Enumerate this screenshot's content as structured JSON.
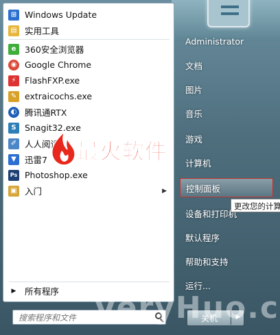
{
  "start_menu": {
    "programs": [
      {
        "label": "Windows Update",
        "icon": "windows-update-icon",
        "color": "#2a6fd0",
        "glyph": "⊞"
      },
      {
        "label": "实用工具",
        "icon": "folder-icon",
        "color": "#e6b53a",
        "glyph": "▤"
      },
      {
        "label": "360安全浏览器",
        "icon": "360-browser-icon",
        "color": "#3fae3a",
        "glyph": "e"
      },
      {
        "label": "Google Chrome",
        "icon": "chrome-icon",
        "color": "#d94a38",
        "glyph": "◉"
      },
      {
        "label": "FlashFXP.exe",
        "icon": "flashfxp-icon",
        "color": "#d33",
        "glyph": "⚡"
      },
      {
        "label": "extraicochs.exe",
        "icon": "extraicochs-icon",
        "color": "#d8a22a",
        "glyph": "✎"
      },
      {
        "label": "腾讯通RTX",
        "icon": "rtx-icon",
        "color": "#1f5fb5",
        "glyph": "◐"
      },
      {
        "label": "Snagit32.exe",
        "icon": "snagit-icon",
        "color": "#2d7fb8",
        "glyph": "S"
      },
      {
        "label": "人人阅读",
        "icon": "reader-icon",
        "color": "#4a86c8",
        "glyph": "✐"
      },
      {
        "label": "迅雷7",
        "icon": "thunder-icon",
        "color": "#2c6ed1",
        "glyph": "▼"
      },
      {
        "label": "Photoshop.exe",
        "icon": "photoshop-icon",
        "color": "#1c3f76",
        "glyph": "Ps"
      },
      {
        "label": "入门",
        "icon": "getting-started-icon",
        "color": "#d6a63a",
        "glyph": "▣"
      }
    ],
    "all_programs": "所有程序",
    "search_placeholder": "搜索程序和文件",
    "right_items": [
      {
        "label": "Administrator"
      },
      {
        "label": "文档"
      },
      {
        "label": "图片"
      },
      {
        "label": "音乐"
      },
      {
        "label": "游戏"
      },
      {
        "label": "计算机"
      },
      {
        "label": "控制面板"
      },
      {
        "label": "设备和打印机"
      },
      {
        "label": "默认程序"
      },
      {
        "label": "帮助和支持"
      },
      {
        "label": "运行..."
      }
    ],
    "tooltip": "更改您的计算",
    "shutdown": "关机"
  },
  "watermark": {
    "logo_text": "最火软件",
    "site": "VeryHuo.com"
  }
}
